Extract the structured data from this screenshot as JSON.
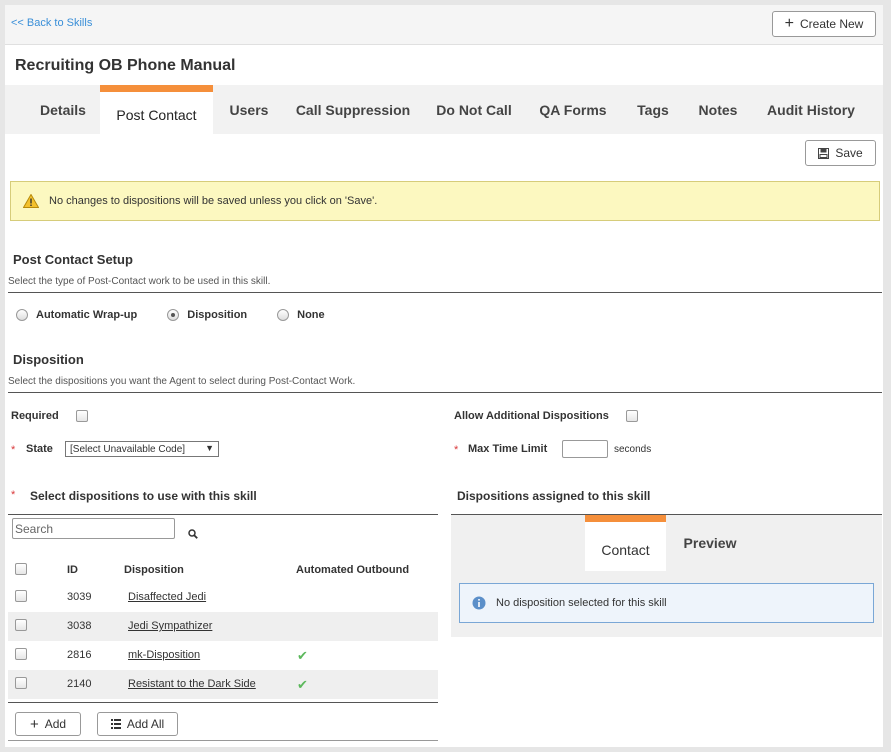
{
  "topbar": {
    "back_link": "<< Back to Skills",
    "create_label": "Create New"
  },
  "page_title": "Recruiting OB Phone Manual",
  "tabs": [
    {
      "label": "Details"
    },
    {
      "label": "Post Contact"
    },
    {
      "label": "Users"
    },
    {
      "label": "Call Suppression"
    },
    {
      "label": "Do Not Call"
    },
    {
      "label": "QA Forms"
    },
    {
      "label": "Tags"
    },
    {
      "label": "Notes"
    },
    {
      "label": "Audit History"
    }
  ],
  "active_tab": "Post Contact",
  "save_label": "Save",
  "warning": "No changes to dispositions will be saved unless you click on 'Save'.",
  "post_contact": {
    "heading": "Post Contact Setup",
    "sub": "Select the type of Post-Contact work to be used in this skill.",
    "options": [
      {
        "label": "Automatic Wrap-up",
        "checked": false
      },
      {
        "label": "Disposition",
        "checked": true
      },
      {
        "label": "None",
        "checked": false
      }
    ]
  },
  "disposition": {
    "heading": "Disposition",
    "sub": "Select the dispositions you want the Agent to select during Post-Contact Work.",
    "required_label": "Required",
    "allow_additional_label": "Allow Additional Dispositions",
    "state_label": "State",
    "state_value": "[Select Unavailable Code]",
    "max_time_label": "Max Time Limit",
    "seconds_label": "seconds",
    "required_marker": "*"
  },
  "select_section": {
    "heading": "Select dispositions to use with this skill",
    "search_placeholder": "Search",
    "columns": [
      "ID",
      "Disposition",
      "Automated Outbound"
    ],
    "rows": [
      {
        "id": "3039",
        "name": "Disaffected Jedi",
        "automated": false
      },
      {
        "id": "3038",
        "name": "Jedi Sympathizer",
        "automated": false
      },
      {
        "id": "2816",
        "name": "mk-Disposition",
        "automated": true
      },
      {
        "id": "2140",
        "name": "Resistant to the Dark Side",
        "automated": true
      }
    ],
    "add_label": "Add",
    "add_all_label": "Add All"
  },
  "assigned_section": {
    "heading": "Dispositions assigned to this skill",
    "tabs": [
      {
        "label": "Contact"
      },
      {
        "label": "Preview"
      }
    ],
    "info": "No disposition selected for this skill"
  },
  "colors": {
    "accent": "#f58f3b",
    "link": "#3a8fd8",
    "warning_bg": "#fcf8c0",
    "check": "#5cb85c"
  }
}
